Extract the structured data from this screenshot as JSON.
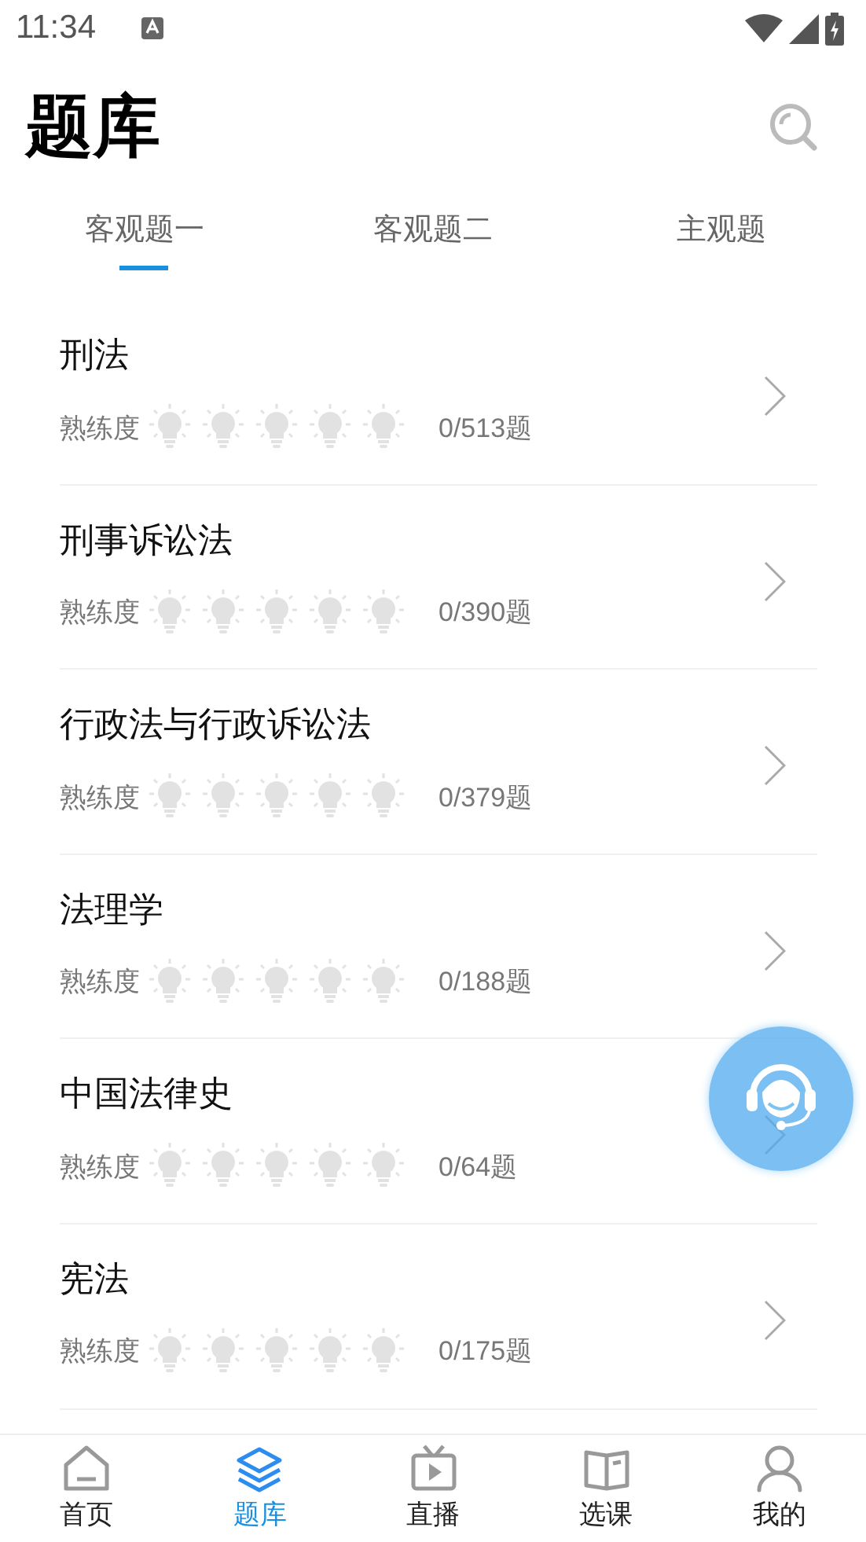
{
  "status_bar": {
    "time": "11:34"
  },
  "header": {
    "title": "题库"
  },
  "tabs": [
    {
      "label": "客观题一",
      "selected": true
    },
    {
      "label": "客观题二",
      "selected": false
    },
    {
      "label": "主观题",
      "selected": false
    }
  ],
  "subjects": [
    {
      "name": "刑法",
      "proficiency_label": "熟练度",
      "stars": 0,
      "count": "0/513题"
    },
    {
      "name": "刑事诉讼法",
      "proficiency_label": "熟练度",
      "stars": 0,
      "count": "0/390题"
    },
    {
      "name": "行政法与行政诉讼法",
      "proficiency_label": "熟练度",
      "stars": 0,
      "count": "0/379题"
    },
    {
      "name": "法理学",
      "proficiency_label": "熟练度",
      "stars": 0,
      "count": "0/188题"
    },
    {
      "name": "中国法律史",
      "proficiency_label": "熟练度",
      "stars": 0,
      "count": "0/64题"
    },
    {
      "name": "宪法",
      "proficiency_label": "熟练度",
      "stars": 0,
      "count": "0/175题"
    }
  ],
  "bottom_nav": [
    {
      "label": "首页",
      "kind": "home",
      "selected": false
    },
    {
      "label": "题库",
      "kind": "layers",
      "selected": true
    },
    {
      "label": "直播",
      "kind": "tv",
      "selected": false
    },
    {
      "label": "选课",
      "kind": "book",
      "selected": false
    },
    {
      "label": "我的",
      "kind": "person",
      "selected": false
    }
  ]
}
